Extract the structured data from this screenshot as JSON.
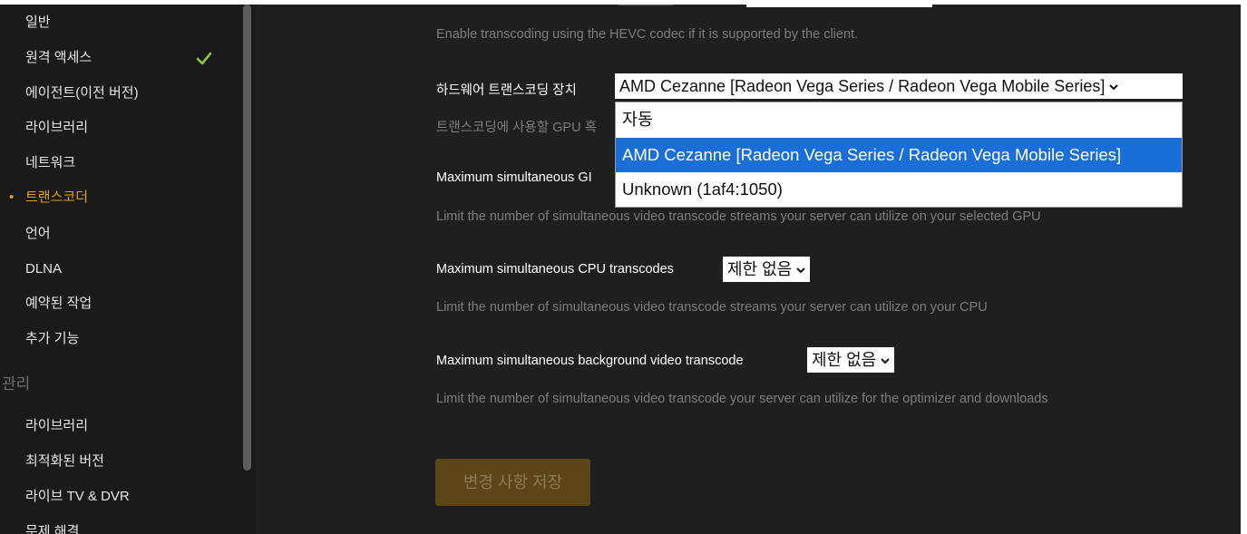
{
  "sidebar": {
    "items": [
      {
        "label": "일반"
      },
      {
        "label": "원격 액세스"
      },
      {
        "label": "에이전트(이전 버전)"
      },
      {
        "label": "라이브러리"
      },
      {
        "label": "네트워크"
      },
      {
        "label": "트랜스코더"
      },
      {
        "label": "언어"
      },
      {
        "label": "DLNA"
      },
      {
        "label": "예약된 작업"
      },
      {
        "label": "추가 기능"
      }
    ],
    "active_index": 5,
    "active_marker": "•",
    "section_label": "관리",
    "section_items": [
      {
        "label": "라이브러리"
      },
      {
        "label": "최적화된 버전"
      },
      {
        "label": "라이브 TV & DVR"
      },
      {
        "label": "문제 해결"
      }
    ],
    "check_icon": "checkmark-icon",
    "check_color": "#8cc63f"
  },
  "settings": {
    "hevc_help": "Enable transcoding using the HEVC codec if it is supported by the client.",
    "hw_device": {
      "label": "하드웨어 트랜스코딩 장치",
      "value": "AMD Cezanne [Radeon Vega Series / Radeon Vega Mobile Series]",
      "help_visible": "트랜스코딩에 사용할 GPU 혹",
      "options": [
        "자동",
        "AMD Cezanne [Radeon Vega Series / Radeon Vega Mobile Series]",
        "Unknown (1af4:1050)"
      ],
      "selected_option_index": 1
    },
    "gpu_transcodes": {
      "label_visible": "Maximum simultaneous GI",
      "help": "Limit the number of simultaneous video transcode streams your server can utilize on your selected GPU"
    },
    "cpu_transcodes": {
      "label": "Maximum simultaneous CPU transcodes",
      "value": "제한 없음",
      "help": "Limit the number of simultaneous video transcode streams your server can utilize on your CPU"
    },
    "background_transcode": {
      "label": "Maximum simultaneous background video transcode",
      "value": "제한 없음",
      "help": "Limit the number of simultaneous video transcode your server can utilize for the optimizer and downloads"
    },
    "save_label": "변경 사항 저장"
  },
  "colors": {
    "accent": "#e5a00d",
    "selection": "#1a6ed8",
    "background": "#1f1f1f"
  }
}
